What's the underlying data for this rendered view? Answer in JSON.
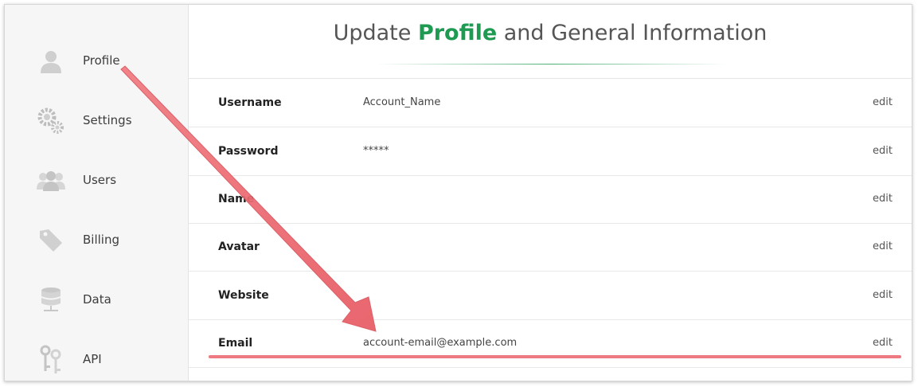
{
  "sidebar": {
    "items": [
      {
        "label": "Profile",
        "icon": "user-icon"
      },
      {
        "label": "Settings",
        "icon": "gears-icon"
      },
      {
        "label": "Users",
        "icon": "users-icon"
      },
      {
        "label": "Billing",
        "icon": "tag-icon"
      },
      {
        "label": "Data",
        "icon": "database-icon"
      },
      {
        "label": "API",
        "icon": "keys-icon"
      }
    ]
  },
  "header": {
    "title_before": "Update ",
    "title_highlight": "Profile",
    "title_after": " and General Information",
    "highlight_color": "#1f9a52"
  },
  "fields": [
    {
      "label": "Username",
      "value": "Account_Name",
      "action": "edit"
    },
    {
      "label": "Password",
      "value": "*****",
      "action": "edit"
    },
    {
      "label": "Name",
      "value": "",
      "action": "edit"
    },
    {
      "label": "Avatar",
      "value": "",
      "action": "edit"
    },
    {
      "label": "Website",
      "value": "",
      "action": "edit"
    },
    {
      "label": "Email",
      "value": "account-email@example.com",
      "action": "edit"
    }
  ],
  "annotation": {
    "color": "#ec6a72",
    "arrow_icon": "arrow-annotation-icon"
  }
}
